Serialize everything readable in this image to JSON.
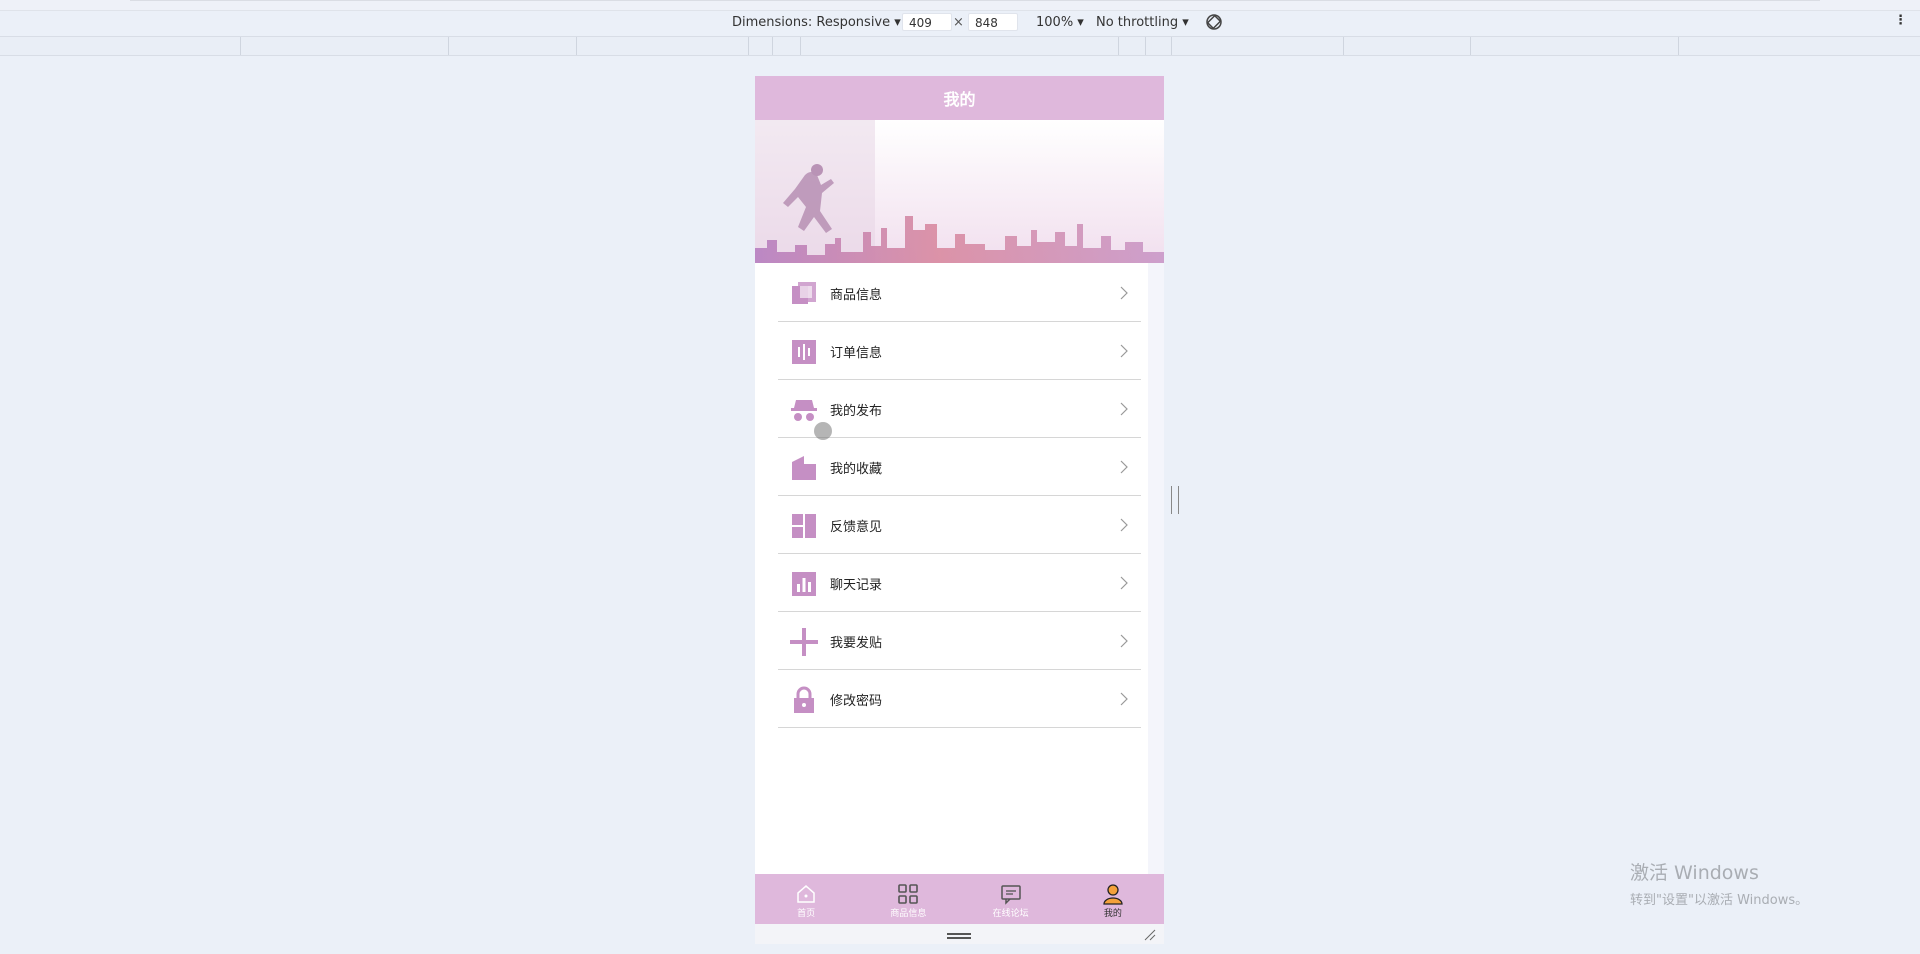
{
  "devtools": {
    "dimensions_label": "Dimensions: Responsive ▾",
    "width": "409",
    "times": "×",
    "height": "848",
    "zoom": "100% ▾",
    "throttle": "No throttling ▾",
    "more": "⋮"
  },
  "app": {
    "title": "我的",
    "menu": [
      {
        "label": "商品信息",
        "icon": "folder-icon"
      },
      {
        "label": "订单信息",
        "icon": "waveform-icon"
      },
      {
        "label": "我的发布",
        "icon": "spy-icon"
      },
      {
        "label": "我的收藏",
        "icon": "factory-icon"
      },
      {
        "label": "反馈意见",
        "icon": "layout-icon"
      },
      {
        "label": "聊天记录",
        "icon": "bar-chart-icon"
      },
      {
        "label": "我要发贴",
        "icon": "plus-icon"
      },
      {
        "label": "修改密码",
        "icon": "lock-icon"
      }
    ],
    "tabs": [
      {
        "label": "首页",
        "icon": "home-icon"
      },
      {
        "label": "商品信息",
        "icon": "grid-icon"
      },
      {
        "label": "在线论坛",
        "icon": "chat-icon"
      },
      {
        "label": "我的",
        "icon": "user-icon",
        "active": true
      }
    ],
    "accent_color": "#dfb8dc",
    "icon_color": "#c58fc4"
  },
  "watermark": {
    "line1": "激活 Windows",
    "line2": "转到\"设置\"以激活 Windows。"
  }
}
